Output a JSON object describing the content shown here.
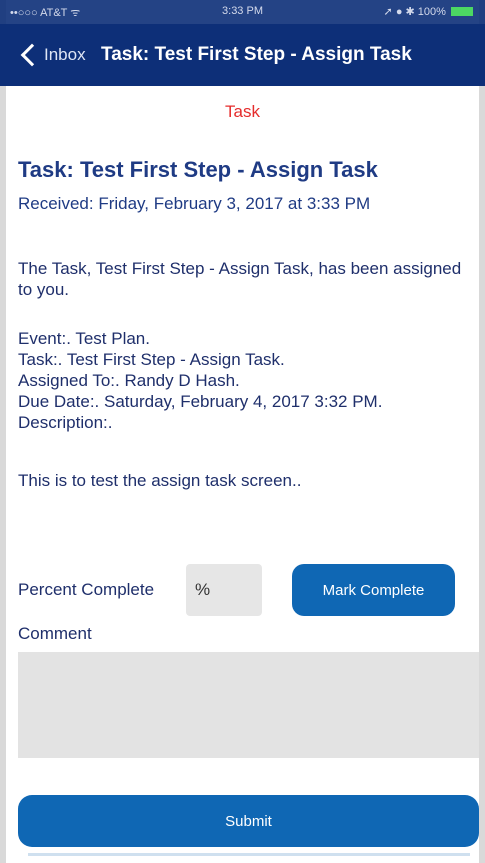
{
  "status_bar": {
    "carrier": "••○○○ AT&T ᯤ",
    "time": "3:33 PM",
    "right": "➚ ● ✱ 100%"
  },
  "nav": {
    "back_label": "Inbox",
    "title": "Task: Test First Step - Assign Task"
  },
  "section_label": "Task",
  "task": {
    "title": "Task: Test First Step - Assign Task",
    "received": "Received: Friday, February 3, 2017 at 3:33 PM",
    "intro": "The Task, Test First Step - Assign Task, has been assigned to you.",
    "details": [
      "Event:. Test Plan.",
      "Task:. Test First Step - Assign Task.",
      "Assigned To:. Randy D Hash.",
      "Due Date:. Saturday, February 4, 2017 3:32 PM.",
      "Description:."
    ],
    "description": "This is to test the assign task screen.."
  },
  "form": {
    "percent_label": "Percent Complete",
    "percent_placeholder": "%",
    "mark_complete_label": "Mark Complete",
    "comment_label": "Comment",
    "comment_value": "",
    "submit_label": "Submit"
  },
  "colors": {
    "nav_bg": "#0d2f78",
    "accent_button": "#0f67b4",
    "section_label": "#e52d2d",
    "input_bg": "#e3e3e3"
  }
}
